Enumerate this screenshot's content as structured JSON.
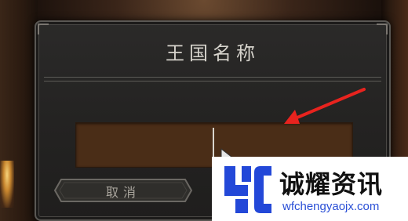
{
  "dialog": {
    "title": "王国名称",
    "name_input": {
      "value": ""
    },
    "cancel_label": "取消"
  },
  "watermark": {
    "name": "诚耀资讯",
    "url": "wfchengyaojx.com"
  },
  "colors": {
    "input_fill": "#4a2d17",
    "arrow": "#e8231e",
    "watermark_brand": "#2348d8"
  },
  "icons": [
    "mouse-cursor-icon",
    "red-arrow-annotation",
    "watermark-logo-icon"
  ]
}
